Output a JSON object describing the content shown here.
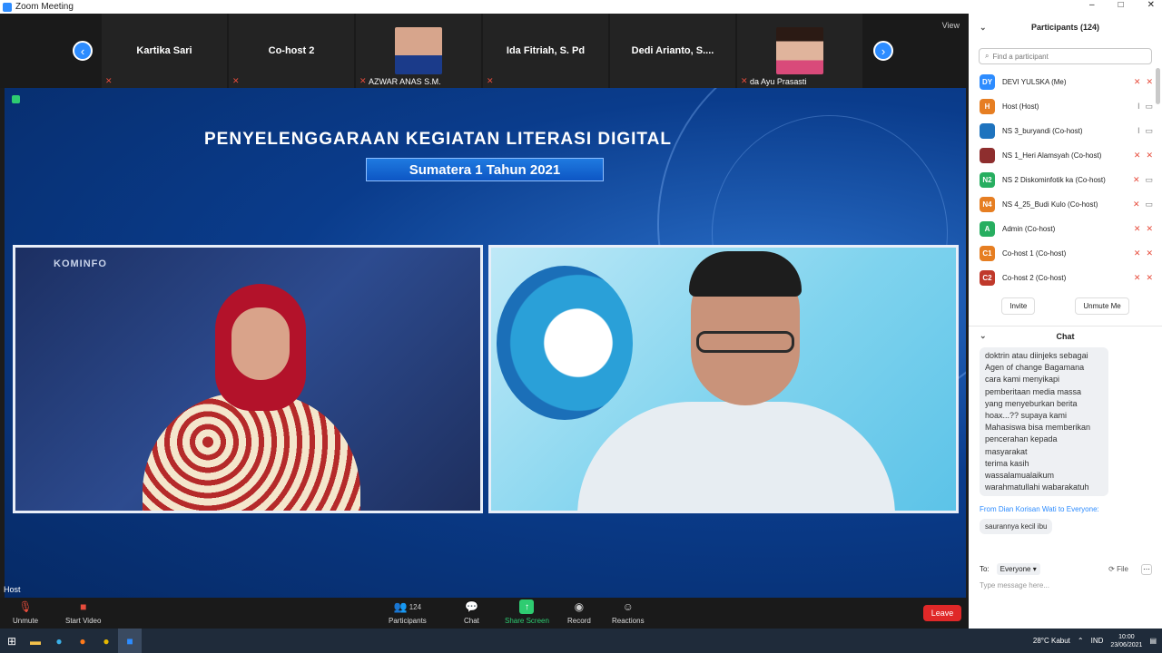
{
  "window": {
    "title": "Zoom Meeting",
    "controls": [
      "–",
      "□",
      "✕"
    ]
  },
  "strip": {
    "tiles": [
      {
        "name": "Kartika Sari",
        "type": "name"
      },
      {
        "name": "Co-host 2",
        "type": "name"
      },
      {
        "name": "AZWAR ANAS S.M.",
        "type": "video"
      },
      {
        "name": "Ida Fitriah, S. Pd",
        "type": "name"
      },
      {
        "name": "Dedi Arianto, S....",
        "type": "name"
      },
      {
        "name": "da Ayu Prasasti",
        "type": "video"
      }
    ],
    "view_label": "View"
  },
  "share": {
    "banner_title": "PENYELENGGARAAN KEGIATAN LITERASI DIGITAL",
    "banner_subtitle": "Sumatera 1 Tahun 2021",
    "left_brand": "KOMINFO"
  },
  "host_label": "Host",
  "toolbar": {
    "unmute": "Unmute",
    "start_video": "Start Video",
    "participants": "Participants",
    "participants_count": "124",
    "chat": "Chat",
    "share_screen": "Share Screen",
    "record": "Record",
    "reactions": "Reactions",
    "leave": "Leave"
  },
  "participants_panel": {
    "title": "Participants (124)",
    "search_placeholder": "Find a participant",
    "rows": [
      {
        "initials": "DY",
        "name": "DEVI YULSKA (Me)",
        "color": "#2d8cff"
      },
      {
        "initials": "H",
        "name": "Host (Host)",
        "color": "#e67e22"
      },
      {
        "initials": "",
        "name": "NS 3_buryandi (Co-host)",
        "color": "#1e73be"
      },
      {
        "initials": "",
        "name": "NS 1_Heri Alamsyah (Co-host)",
        "color": "#8e2e2e"
      },
      {
        "initials": "N2",
        "name": "NS 2 Diskominfotik ka (Co-host)",
        "color": "#27ae60"
      },
      {
        "initials": "N4",
        "name": "NS 4_25_Budi Kulo (Co-host)",
        "color": "#e67e22"
      },
      {
        "initials": "A",
        "name": "Admin (Co-host)",
        "color": "#27ae60"
      },
      {
        "initials": "C1",
        "name": "Co-host 1 (Co-host)",
        "color": "#e67e22"
      },
      {
        "initials": "C2",
        "name": "Co-host 2 (Co-host)",
        "color": "#c0392b"
      }
    ],
    "invite": "Invite",
    "unmute_me": "Unmute Me"
  },
  "chat_panel": {
    "title": "Chat",
    "message_lines": [
      "doktrin atau diinjeks sebagai",
      "Agen of change Bagamana",
      "cara kami menyikapi",
      "pemberitaan media massa",
      "yang menyeburkan berita",
      "hoax...?? supaya kami",
      "Mahasiswa bisa memberikan",
      "pencerahan kepada",
      "masyarakat",
      "terima kasih",
      "wassalamualaikum",
      "warahmatullahi wabarakatuh"
    ],
    "from_line": "From Dian Korisan Wati to Everyone:",
    "reply": "saurannya kecil ibu",
    "to_label": "To:",
    "to_value": "Everyone",
    "file_label": "File",
    "input_placeholder": "Type message here..."
  },
  "taskbar": {
    "weather": "28°C Kabut",
    "lang": "IND",
    "time": "10:00",
    "date": "23/06/2021"
  }
}
